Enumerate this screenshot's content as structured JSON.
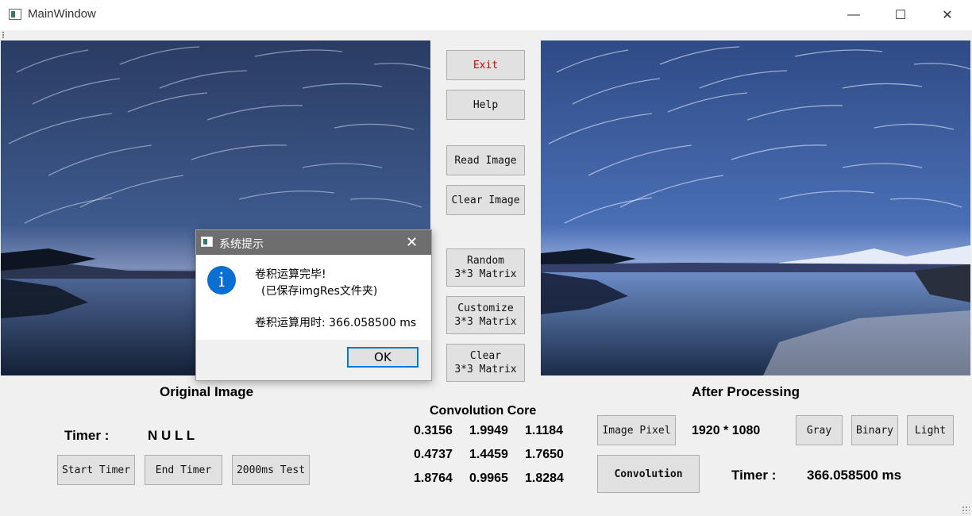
{
  "window": {
    "title": "MainWindow",
    "controls": {
      "minimize": "—",
      "maximize": "☐",
      "close": "✕"
    }
  },
  "buttons": {
    "exit": "Exit",
    "help": "Help",
    "read_image": "Read Image",
    "clear_image": "Clear Image",
    "random_matrix": "Random\n3*3 Matrix",
    "customize_matrix": "Customize\n3*3 Matrix",
    "clear_matrix": "Clear\n3*3 Matrix",
    "start_timer": "Start Timer",
    "end_timer": "End Timer",
    "test_2000ms": "2000ms Test",
    "image_pixel": "Image Pixel",
    "gray": "Gray",
    "binary": "Binary",
    "light": "Light",
    "convolution": "Convolution"
  },
  "labels": {
    "original_image": "Original Image",
    "after_processing": "After Processing",
    "timer_left": "Timer :",
    "timer_left_value": "N U L L",
    "convolution_core": "Convolution Core",
    "pixel_value": "1920 * 1080",
    "timer_right": "Timer :",
    "timer_right_value": "366.058500 ms"
  },
  "kernel": [
    [
      "0.3156",
      "1.9949",
      "1.1184"
    ],
    [
      "0.4737",
      "1.4459",
      "1.7650"
    ],
    [
      "1.8764",
      "0.9965",
      "1.8284"
    ]
  ],
  "dialog": {
    "title": "系统提示",
    "line1": "卷积运算完毕!",
    "line2": "(已保存imgRes文件夹)",
    "line3": "卷积运算用时: 366.058500 ms",
    "ok": "OK",
    "close": "✕",
    "icon": "info-icon"
  },
  "colors": {
    "exit_text": "#d40000",
    "dialog_accent": "#0078d7",
    "info_icon": "#0a6fd1"
  }
}
